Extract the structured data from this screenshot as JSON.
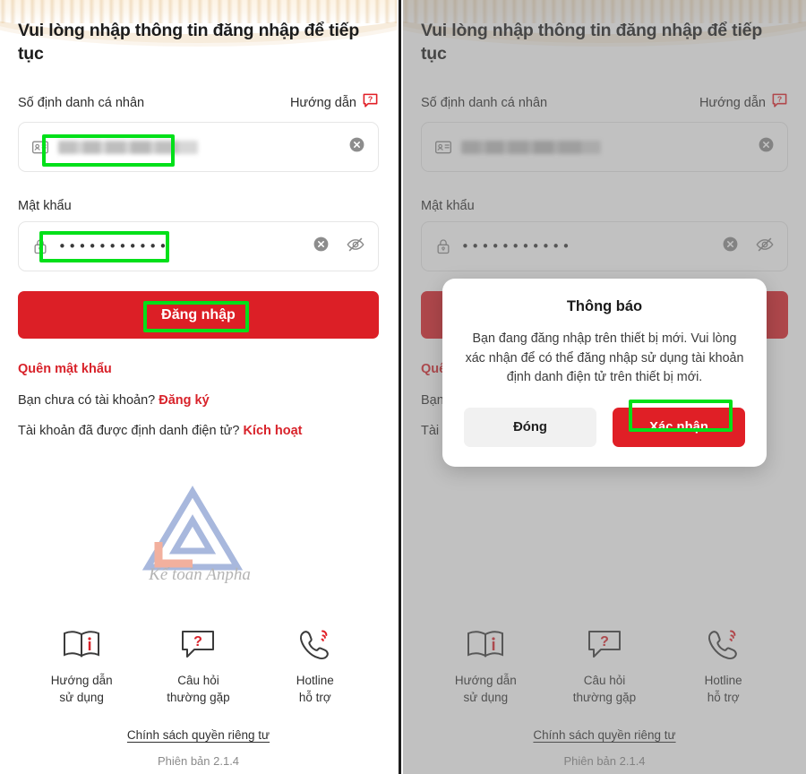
{
  "app": {
    "title": "Vui lòng nhập thông tin đăng nhập để tiếp tục",
    "version": "Phiên bản 2.1.4",
    "privacy_policy": "Chính sách quyền riêng tư"
  },
  "form": {
    "id_label": "Số định danh cá nhân",
    "helper_label": "Hướng dẫn",
    "helper_icon": "question-bubble-icon",
    "id_icon": "id-card-icon",
    "id_value": "",
    "id_value_redacted": true,
    "clear_icon": "clear-circle-icon",
    "password_label": "Mật khẩu",
    "password_icon": "lock-icon",
    "password_value": "•••••••••••",
    "password_visibility_icon": "eye-off-icon",
    "submit_label": "Đăng nhập"
  },
  "links": {
    "forgot_password": "Quên mật khẩu",
    "no_account_prefix": "Bạn chưa có tài khoản?",
    "register": "Đăng ký",
    "activated_prefix": "Tài khoản đã được định danh điện tử?",
    "activate": "Kích hoạt"
  },
  "logo": {
    "brand_script": "Kế toán Anpha",
    "mark_color_primary": "#a8b8dd",
    "mark_color_accent": "#f2b09e"
  },
  "footer": {
    "items": [
      {
        "icon": "book-info-icon",
        "label": "Hướng dẫn\nsử dụng"
      },
      {
        "icon": "question-bubble-icon",
        "label": "Câu hỏi\nthường gặp"
      },
      {
        "icon": "phone-ring-icon",
        "label": "Hotline\nhỗ trợ"
      }
    ]
  },
  "modal": {
    "title": "Thông báo",
    "message": "Bạn đang đăng nhập trên thiết bị mới. Vui lòng xác nhận để có thể đăng nhập sử dụng tài khoản định danh điện tử trên thiết bị mới.",
    "close_label": "Đóng",
    "confirm_label": "Xác nhận"
  },
  "annotations": {
    "highlight_color": "#00e019",
    "left_panel": [
      "id-input-value",
      "password-input-value",
      "login-button-label"
    ],
    "right_panel": [
      "confirm-button-label"
    ]
  },
  "colors": {
    "brand_red": "#dc1f26",
    "link_red": "#d8222a",
    "overlay": "rgba(120,120,120,0.46)"
  }
}
